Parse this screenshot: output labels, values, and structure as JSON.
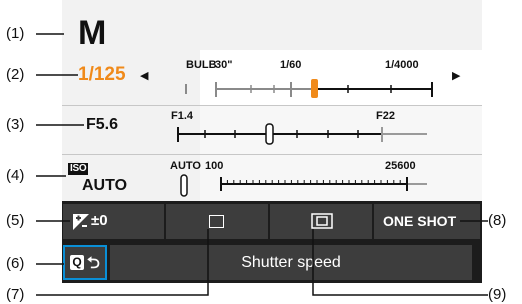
{
  "callouts": {
    "c1": "(1)",
    "c2": "(2)",
    "c3": "(3)",
    "c4": "(4)",
    "c5": "(5)",
    "c6": "(6)",
    "c7": "(7)",
    "c8": "(8)",
    "c9": "(9)"
  },
  "shooting_mode": "M",
  "shutter": {
    "value": "1/125",
    "value_color": "#f08a1a",
    "scale_labels": [
      "BULB",
      "30\"",
      "1/60",
      "1/4000"
    ],
    "left_arrow_icon": "left-triangle-icon",
    "right_arrow_icon": "right-triangle-icon"
  },
  "aperture": {
    "value": "F5.6",
    "scale_labels": [
      "F1.4",
      "F22"
    ]
  },
  "iso": {
    "badge": "ISO",
    "value": "AUTO",
    "scale_labels": [
      "AUTO",
      "100",
      "25600"
    ]
  },
  "bottom_bar": {
    "exposure_comp": "±0",
    "exposure_comp_icon": "exposure-compensation-icon",
    "drive_icon": "drive-mode-single-icon",
    "metering_icon": "metering-partial-icon",
    "af_operation": "ONE SHOT",
    "q_key": "Q",
    "back_icon": "return-arrow-icon",
    "hint": "Shutter speed"
  },
  "colors": {
    "accent_orange": "#f08a1a",
    "selection_blue": "#0a8fd6",
    "panel_bg": "#f2f2f2",
    "bar_bg": "#1c1c1c",
    "cell_bg": "#3d3d3d"
  }
}
